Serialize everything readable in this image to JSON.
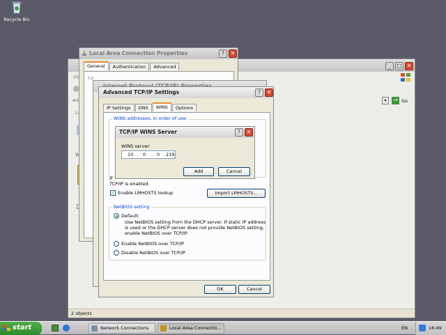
{
  "desktop": {
    "recycle_bin_label": "Recycle Bin"
  },
  "explorer": {
    "menu_fragment": "Fil",
    "address_fragment": "Add",
    "go_label": "Go",
    "status": "2 objects",
    "side_fragments": [
      "La",
      "W"
    ]
  },
  "lac_props": {
    "title": "Local Area Connection Properties",
    "tabs": [
      "General",
      "Authentication",
      "Advanced"
    ],
    "connect_fragment": "Co"
  },
  "tcpip_props": {
    "title": "Internet Protocol (TCP/IP) Properties"
  },
  "advanced": {
    "title": "Advanced TCP/IP Settings",
    "tabs": [
      "IP Settings",
      "DNS",
      "WINS",
      "Options"
    ],
    "wins_list_label": "WINS addresses, in order of use:",
    "lmhosts_fragment_1": "If",
    "lmhosts_fragment_2": "TCP/IP is enabled.",
    "enable_lmhosts_label": "Enable LMHOSTS lookup",
    "import_lmhosts_label": "Import LMHOSTS...",
    "netbios_group_label": "NetBIOS setting",
    "default_label": "Default:",
    "default_desc": [
      "Use NetBIOS setting from the DHCP server. If static IP address",
      "is used or the DHCP server does not provide NetBIOS setting,",
      "enable NetBIOS over TCP/IP."
    ],
    "enable_netbios_label": "Enable NetBIOS over TCP/IP",
    "disable_netbios_label": "Disable NetBIOS over TCP/IP",
    "ok_label": "OK",
    "cancel_label": "Cancel"
  },
  "wins_dialog": {
    "title": "TCP/IP WINS Server",
    "server_label": "WINS server:",
    "ip": [
      "10",
      "0",
      "0",
      "219"
    ],
    "add_label": "Add",
    "cancel_label": "Cancel"
  },
  "taskbar": {
    "start_label": "start",
    "items": [
      "Network Connections",
      "Local Area Connectio..."
    ],
    "language": "EN",
    "clock": "16:49"
  },
  "colors": {
    "title_close": "#d8482e",
    "start_green": "#3a9a35",
    "group_label_blue": "#0046d5"
  }
}
